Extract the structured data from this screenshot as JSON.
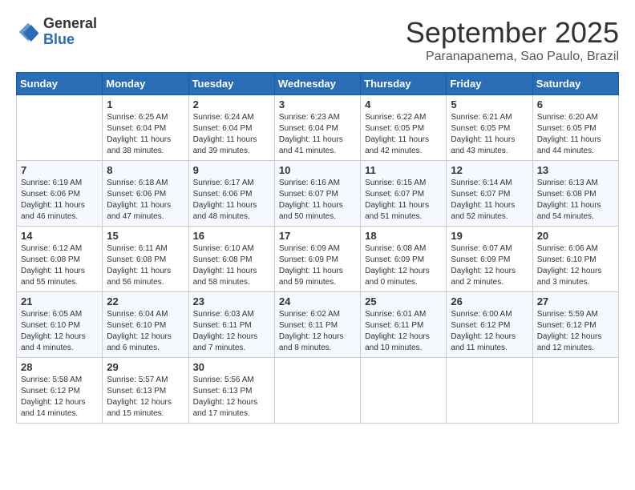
{
  "logo": {
    "general": "General",
    "blue": "Blue"
  },
  "header": {
    "month": "September 2025",
    "location": "Paranapanema, Sao Paulo, Brazil"
  },
  "weekdays": [
    "Sunday",
    "Monday",
    "Tuesday",
    "Wednesday",
    "Thursday",
    "Friday",
    "Saturday"
  ],
  "weeks": [
    [
      {
        "day": "",
        "info": ""
      },
      {
        "day": "1",
        "info": "Sunrise: 6:25 AM\nSunset: 6:04 PM\nDaylight: 11 hours\nand 38 minutes."
      },
      {
        "day": "2",
        "info": "Sunrise: 6:24 AM\nSunset: 6:04 PM\nDaylight: 11 hours\nand 39 minutes."
      },
      {
        "day": "3",
        "info": "Sunrise: 6:23 AM\nSunset: 6:04 PM\nDaylight: 11 hours\nand 41 minutes."
      },
      {
        "day": "4",
        "info": "Sunrise: 6:22 AM\nSunset: 6:05 PM\nDaylight: 11 hours\nand 42 minutes."
      },
      {
        "day": "5",
        "info": "Sunrise: 6:21 AM\nSunset: 6:05 PM\nDaylight: 11 hours\nand 43 minutes."
      },
      {
        "day": "6",
        "info": "Sunrise: 6:20 AM\nSunset: 6:05 PM\nDaylight: 11 hours\nand 44 minutes."
      }
    ],
    [
      {
        "day": "7",
        "info": "Sunrise: 6:19 AM\nSunset: 6:06 PM\nDaylight: 11 hours\nand 46 minutes."
      },
      {
        "day": "8",
        "info": "Sunrise: 6:18 AM\nSunset: 6:06 PM\nDaylight: 11 hours\nand 47 minutes."
      },
      {
        "day": "9",
        "info": "Sunrise: 6:17 AM\nSunset: 6:06 PM\nDaylight: 11 hours\nand 48 minutes."
      },
      {
        "day": "10",
        "info": "Sunrise: 6:16 AM\nSunset: 6:07 PM\nDaylight: 11 hours\nand 50 minutes."
      },
      {
        "day": "11",
        "info": "Sunrise: 6:15 AM\nSunset: 6:07 PM\nDaylight: 11 hours\nand 51 minutes."
      },
      {
        "day": "12",
        "info": "Sunrise: 6:14 AM\nSunset: 6:07 PM\nDaylight: 11 hours\nand 52 minutes."
      },
      {
        "day": "13",
        "info": "Sunrise: 6:13 AM\nSunset: 6:08 PM\nDaylight: 11 hours\nand 54 minutes."
      }
    ],
    [
      {
        "day": "14",
        "info": "Sunrise: 6:12 AM\nSunset: 6:08 PM\nDaylight: 11 hours\nand 55 minutes."
      },
      {
        "day": "15",
        "info": "Sunrise: 6:11 AM\nSunset: 6:08 PM\nDaylight: 11 hours\nand 56 minutes."
      },
      {
        "day": "16",
        "info": "Sunrise: 6:10 AM\nSunset: 6:08 PM\nDaylight: 11 hours\nand 58 minutes."
      },
      {
        "day": "17",
        "info": "Sunrise: 6:09 AM\nSunset: 6:09 PM\nDaylight: 11 hours\nand 59 minutes."
      },
      {
        "day": "18",
        "info": "Sunrise: 6:08 AM\nSunset: 6:09 PM\nDaylight: 12 hours\nand 0 minutes."
      },
      {
        "day": "19",
        "info": "Sunrise: 6:07 AM\nSunset: 6:09 PM\nDaylight: 12 hours\nand 2 minutes."
      },
      {
        "day": "20",
        "info": "Sunrise: 6:06 AM\nSunset: 6:10 PM\nDaylight: 12 hours\nand 3 minutes."
      }
    ],
    [
      {
        "day": "21",
        "info": "Sunrise: 6:05 AM\nSunset: 6:10 PM\nDaylight: 12 hours\nand 4 minutes."
      },
      {
        "day": "22",
        "info": "Sunrise: 6:04 AM\nSunset: 6:10 PM\nDaylight: 12 hours\nand 6 minutes."
      },
      {
        "day": "23",
        "info": "Sunrise: 6:03 AM\nSunset: 6:11 PM\nDaylight: 12 hours\nand 7 minutes."
      },
      {
        "day": "24",
        "info": "Sunrise: 6:02 AM\nSunset: 6:11 PM\nDaylight: 12 hours\nand 8 minutes."
      },
      {
        "day": "25",
        "info": "Sunrise: 6:01 AM\nSunset: 6:11 PM\nDaylight: 12 hours\nand 10 minutes."
      },
      {
        "day": "26",
        "info": "Sunrise: 6:00 AM\nSunset: 6:12 PM\nDaylight: 12 hours\nand 11 minutes."
      },
      {
        "day": "27",
        "info": "Sunrise: 5:59 AM\nSunset: 6:12 PM\nDaylight: 12 hours\nand 12 minutes."
      }
    ],
    [
      {
        "day": "28",
        "info": "Sunrise: 5:58 AM\nSunset: 6:12 PM\nDaylight: 12 hours\nand 14 minutes."
      },
      {
        "day": "29",
        "info": "Sunrise: 5:57 AM\nSunset: 6:13 PM\nDaylight: 12 hours\nand 15 minutes."
      },
      {
        "day": "30",
        "info": "Sunrise: 5:56 AM\nSunset: 6:13 PM\nDaylight: 12 hours\nand 17 minutes."
      },
      {
        "day": "",
        "info": ""
      },
      {
        "day": "",
        "info": ""
      },
      {
        "day": "",
        "info": ""
      },
      {
        "day": "",
        "info": ""
      }
    ]
  ]
}
